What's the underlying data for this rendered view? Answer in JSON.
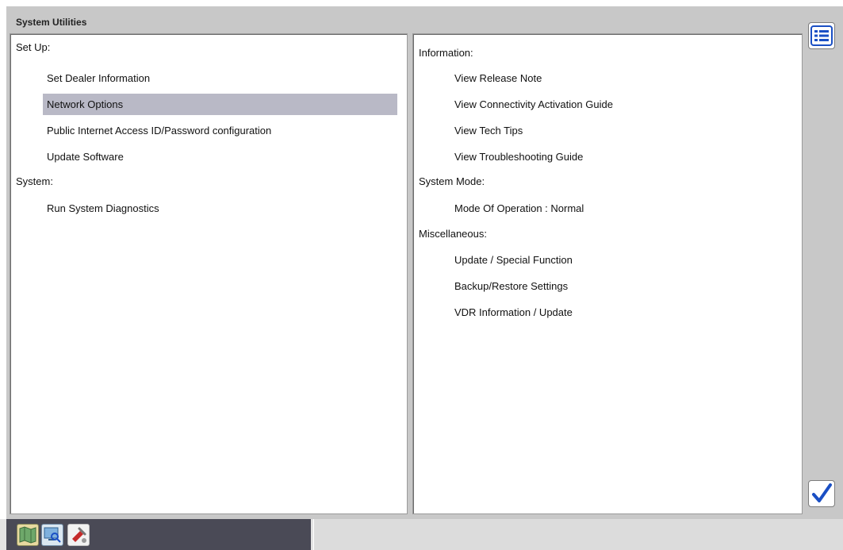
{
  "window": {
    "title": "System Utilities"
  },
  "left_panel": {
    "setup_heading": "Set Up:",
    "setup_items": [
      {
        "label": "Set Dealer Information"
      },
      {
        "label": "Network Options",
        "selected": true
      },
      {
        "label": "Public Internet Access ID/Password configuration"
      },
      {
        "label": "Update Software"
      }
    ],
    "system_heading": "System:",
    "system_items": [
      {
        "label": "Run System Diagnostics"
      }
    ]
  },
  "right_panel": {
    "information_heading": "Information:",
    "information_items": [
      {
        "label": "View Release Note"
      },
      {
        "label": "View Connectivity Activation Guide"
      },
      {
        "label": "View Tech Tips"
      },
      {
        "label": "View Troubleshooting Guide"
      }
    ],
    "system_mode_heading": "System Mode:",
    "system_mode_items": [
      {
        "label": "Mode Of Operation : Normal"
      }
    ],
    "misc_heading": "Miscellaneous:",
    "misc_items": [
      {
        "label": "Update / Special Function"
      },
      {
        "label": "Backup/Restore Settings"
      },
      {
        "label": "VDR Information / Update"
      }
    ]
  },
  "side_buttons": {
    "top_icon": "list-menu-icon",
    "bottom_icon": "checkmark-icon"
  },
  "taskbar": {
    "icons": [
      "map-icon",
      "computer-search-icon",
      "tools-icon"
    ]
  },
  "colors": {
    "selection": "#b9b9c6",
    "accent_blue": "#1a4fc4",
    "taskbar_dark": "#4a4a56"
  }
}
